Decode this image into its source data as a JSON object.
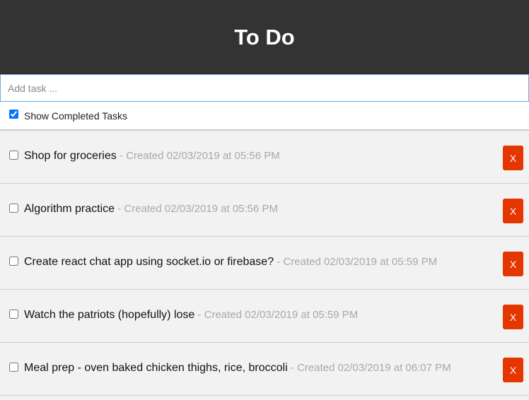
{
  "header": {
    "title": "To Do"
  },
  "add_task": {
    "placeholder": "Add task ...",
    "value": ""
  },
  "filter": {
    "show_completed_label": "Show Completed Tasks",
    "show_completed_checked": true
  },
  "tasks": [
    {
      "text": "Shop for groceries",
      "meta": " - Created 02/03/2019 at 05:56 PM",
      "completed": false,
      "delete_label": "X"
    },
    {
      "text": "Algorithm practice",
      "meta": " - Created 02/03/2019 at 05:56 PM",
      "completed": false,
      "delete_label": "X"
    },
    {
      "text": "Create react chat app using socket.io or firebase?",
      "meta": " - Created 02/03/2019 at 05:59 PM",
      "completed": false,
      "delete_label": "X"
    },
    {
      "text": "Watch the patriots (hopefully) lose",
      "meta": " - Created 02/03/2019 at 05:59 PM",
      "completed": false,
      "delete_label": "X"
    },
    {
      "text": "Meal prep - oven baked chicken thighs, rice, broccoli",
      "meta": " - Created 02/03/2019 at 06:07 PM",
      "completed": false,
      "delete_label": "X"
    }
  ],
  "colors": {
    "header_bg": "#333333",
    "delete_button": "#e53600",
    "meta_text": "#a9a9a9"
  }
}
